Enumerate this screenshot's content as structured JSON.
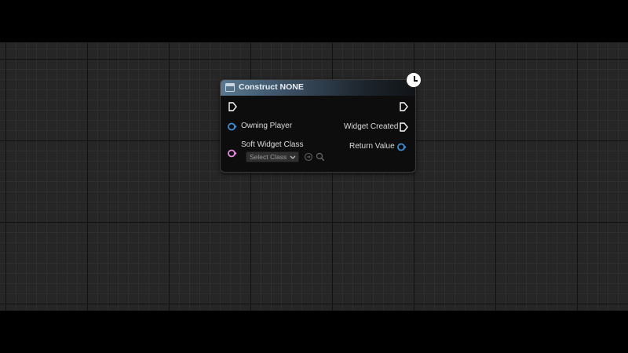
{
  "node": {
    "title": "Construct NONE",
    "inputs": {
      "owning_player": "Owning Player",
      "soft_widget_class": "Soft Widget Class",
      "class_select_value": "Select Class"
    },
    "outputs": {
      "widget_created": "Widget Created",
      "return_value": "Return Value"
    }
  },
  "colors": {
    "object_pin": "#3f8fd6",
    "soft_class_pin": "#e58be3",
    "exec_pin": "#ffffff"
  },
  "icons": {
    "header": "widget-blueprint-icon",
    "latent": "clock-icon",
    "use_selected": "use-selected-asset-icon",
    "browse": "search-icon"
  }
}
